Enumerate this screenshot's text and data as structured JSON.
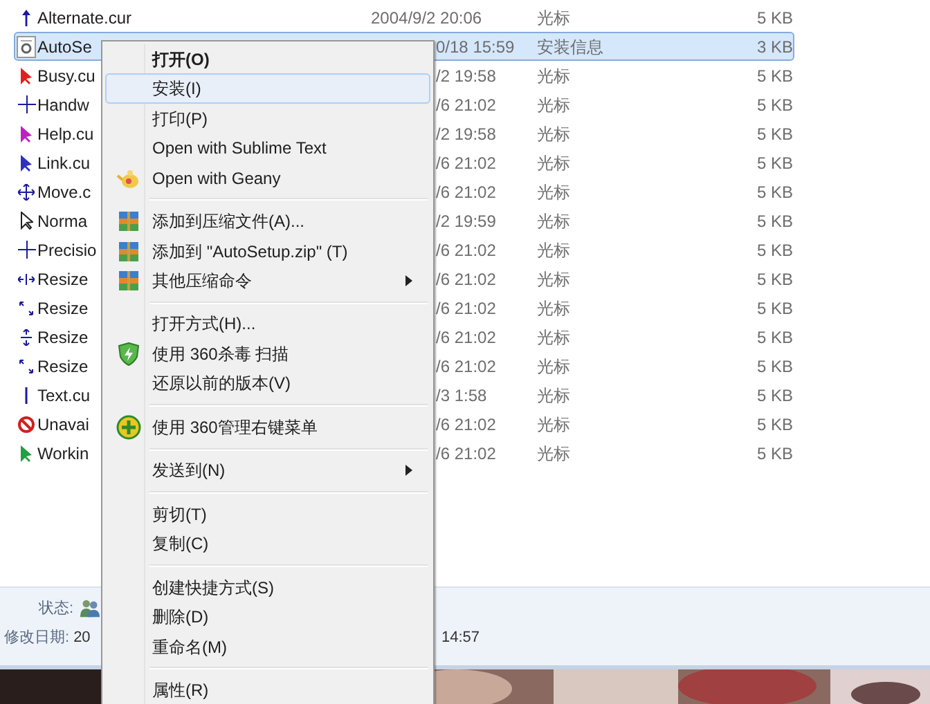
{
  "files": [
    {
      "name": "Alternate.cur",
      "date": "2004/9/2 20:06",
      "type": "光标",
      "size": "5 KB",
      "kind": "arrow-up",
      "color": "#1a1aa0",
      "selected": false
    },
    {
      "name": "AutoSe",
      "date": "0/18 15:59",
      "type": "安装信息",
      "size": "3 KB",
      "kind": "gear-doc",
      "selected": true
    },
    {
      "name": "Busy.cu",
      "date": "/2 19:58",
      "type": "光标",
      "size": "5 KB",
      "kind": "pointer",
      "color": "#e02020",
      "selected": false
    },
    {
      "name": "Handw",
      "date": "/6 21:02",
      "type": "光标",
      "size": "5 KB",
      "kind": "cross",
      "color": "#1a1aa0",
      "selected": false
    },
    {
      "name": "Help.cu",
      "date": "/2 19:58",
      "type": "光标",
      "size": "5 KB",
      "kind": "pointer",
      "color": "#c020c0",
      "selected": false
    },
    {
      "name": "Link.cu",
      "date": "/6 21:02",
      "type": "光标",
      "size": "5 KB",
      "kind": "pointer",
      "color": "#3030c0",
      "selected": false
    },
    {
      "name": "Move.c",
      "date": "/6 21:02",
      "type": "光标",
      "size": "5 KB",
      "kind": "move",
      "color": "#1a1aa0",
      "selected": false
    },
    {
      "name": "Norma",
      "date": "/2 19:59",
      "type": "光标",
      "size": "5 KB",
      "kind": "pointer-outline",
      "color": "#202020",
      "selected": false
    },
    {
      "name": "Precisio",
      "date": "/6 21:02",
      "type": "光标",
      "size": "5 KB",
      "kind": "cross",
      "color": "#1a1aa0",
      "selected": false
    },
    {
      "name": "Resize",
      "date": "/6 21:02",
      "type": "光标",
      "size": "5 KB",
      "kind": "resize-h",
      "color": "#1a1aa0",
      "selected": false
    },
    {
      "name": "Resize",
      "date": "/6 21:02",
      "type": "光标",
      "size": "5 KB",
      "kind": "resize-d",
      "color": "#1a1aa0",
      "selected": false
    },
    {
      "name": "Resize",
      "date": "/6 21:02",
      "type": "光标",
      "size": "5 KB",
      "kind": "resize-v",
      "color": "#1a1aa0",
      "selected": false
    },
    {
      "name": "Resize",
      "date": "/6 21:02",
      "type": "光标",
      "size": "5 KB",
      "kind": "resize-d",
      "color": "#1a1aa0",
      "selected": false
    },
    {
      "name": "Text.cu",
      "date": "/3 1:58",
      "type": "光标",
      "size": "5 KB",
      "kind": "ibeam",
      "color": "#1a1aa0",
      "selected": false
    },
    {
      "name": "Unavai",
      "date": "/6 21:02",
      "type": "光标",
      "size": "5 KB",
      "kind": "no",
      "color": "#d02020",
      "selected": false
    },
    {
      "name": "Workin",
      "date": "/6 21:02",
      "type": "光标",
      "size": "5 KB",
      "kind": "pointer",
      "color": "#20a040",
      "selected": false
    }
  ],
  "details": {
    "status_label": "状态:",
    "modified_label": "修改日期:",
    "modified_start": "20",
    "modified_end": "14:57"
  },
  "menu": [
    {
      "kind": "item",
      "label": "打开(O)",
      "bold": true,
      "selected": false
    },
    {
      "kind": "item",
      "label": "安装(I)",
      "bold": false,
      "selected": true
    },
    {
      "kind": "item",
      "label": "打印(P)",
      "bold": false,
      "selected": false
    },
    {
      "kind": "item",
      "label": "Open with Sublime Text",
      "bold": false,
      "selected": false
    },
    {
      "kind": "geany",
      "label": "Open with Geany",
      "bold": false,
      "selected": false
    },
    {
      "kind": "separator"
    },
    {
      "kind": "archive",
      "label": "添加到压缩文件(A)...",
      "bold": false,
      "selected": false
    },
    {
      "kind": "archive",
      "label": "添加到 \"AutoSetup.zip\" (T)",
      "bold": false,
      "selected": false
    },
    {
      "kind": "archive",
      "label": "其他压缩命令",
      "bold": false,
      "selected": false,
      "submenu": true
    },
    {
      "kind": "separator"
    },
    {
      "kind": "item",
      "label": "打开方式(H)...",
      "bold": false,
      "selected": false
    },
    {
      "kind": "shield",
      "label": "使用 360杀毒 扫描",
      "bold": false,
      "selected": false
    },
    {
      "kind": "item",
      "label": "还原以前的版本(V)",
      "bold": false,
      "selected": false
    },
    {
      "kind": "separator"
    },
    {
      "kind": "plus",
      "label": "使用 360管理右键菜单",
      "bold": false,
      "selected": false
    },
    {
      "kind": "separator"
    },
    {
      "kind": "item",
      "label": "发送到(N)",
      "bold": false,
      "selected": false,
      "submenu": true
    },
    {
      "kind": "separator"
    },
    {
      "kind": "item",
      "label": "剪切(T)",
      "bold": false,
      "selected": false
    },
    {
      "kind": "item",
      "label": "复制(C)",
      "bold": false,
      "selected": false
    },
    {
      "kind": "separator"
    },
    {
      "kind": "item",
      "label": "创建快捷方式(S)",
      "bold": false,
      "selected": false
    },
    {
      "kind": "item",
      "label": "删除(D)",
      "bold": false,
      "selected": false
    },
    {
      "kind": "item",
      "label": "重命名(M)",
      "bold": false,
      "selected": false
    },
    {
      "kind": "separator"
    },
    {
      "kind": "item",
      "label": "属性(R)",
      "bold": false,
      "selected": false
    }
  ]
}
